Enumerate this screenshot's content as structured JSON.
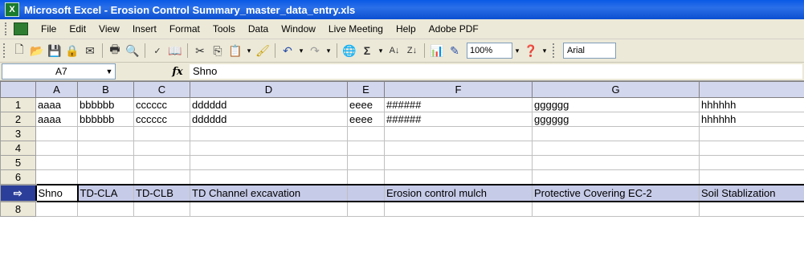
{
  "window": {
    "title": "Microsoft Excel - Erosion Control Summary_master_data_entry.xls"
  },
  "menu": [
    "File",
    "Edit",
    "View",
    "Insert",
    "Format",
    "Tools",
    "Data",
    "Window",
    "Live Meeting",
    "Help",
    "Adobe PDF"
  ],
  "toolbar": {
    "zoom": "100%",
    "font": "Arial"
  },
  "formula_bar": {
    "name_box": "A7",
    "fx_label": "fx",
    "value": "Shno"
  },
  "columns": [
    "A",
    "B",
    "C",
    "D",
    "E",
    "F",
    "G",
    ""
  ],
  "rows": [
    {
      "num": "1",
      "cells": [
        "aaaa",
        "bbbbbb",
        "cccccc",
        "dddddd",
        "eeee",
        "######",
        "gggggg",
        "hhhhhh"
      ]
    },
    {
      "num": "2",
      "cells": [
        "aaaa",
        "bbbbbb",
        "cccccc",
        "dddddd",
        "eeee",
        "######",
        "gggggg",
        "hhhhhh"
      ]
    },
    {
      "num": "3",
      "cells": [
        "",
        "",
        "",
        "",
        "",
        "",
        "",
        ""
      ]
    },
    {
      "num": "4",
      "cells": [
        "",
        "",
        "",
        "",
        "",
        "",
        "",
        ""
      ]
    },
    {
      "num": "5",
      "cells": [
        "",
        "",
        "",
        "",
        "",
        "",
        "",
        ""
      ]
    },
    {
      "num": "6",
      "cells": [
        "",
        "",
        "",
        "",
        "",
        "",
        "",
        ""
      ]
    },
    {
      "num": "⇨",
      "cells": [
        "Shno",
        "TD-CLA",
        "TD-CLB",
        "TD Channel excavation",
        "",
        "Erosion control mulch",
        "Protective Covering EC-2",
        "Soil Stablization"
      ]
    },
    {
      "num": "8",
      "cells": [
        "",
        "",
        "",
        "",
        "",
        "",
        "",
        ""
      ]
    }
  ]
}
